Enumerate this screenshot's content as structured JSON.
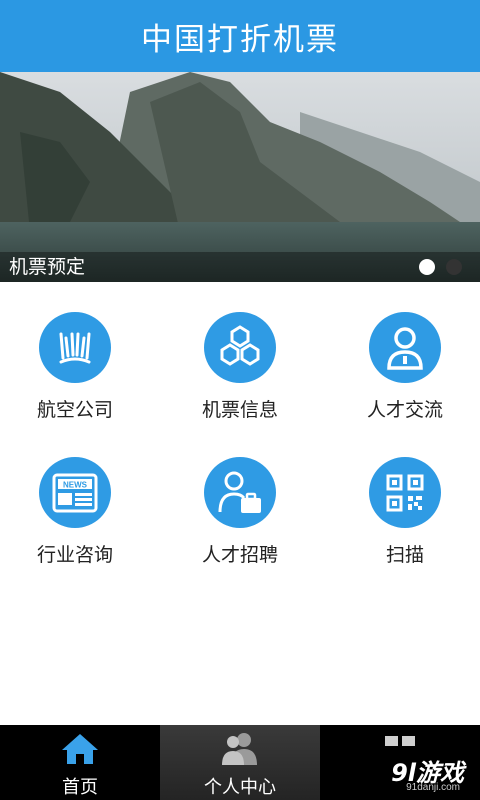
{
  "header": {
    "title": "中国打折机票"
  },
  "banner": {
    "caption": "机票预定",
    "slides_total": 2,
    "active_slide": 1
  },
  "menu": {
    "items": [
      {
        "label": "航空公司",
        "icon": "airline-book-icon"
      },
      {
        "label": "机票信息",
        "icon": "hexagons-icon"
      },
      {
        "label": "人才交流",
        "icon": "person-icon"
      },
      {
        "label": "行业咨询",
        "icon": "news-icon"
      },
      {
        "label": "人才招聘",
        "icon": "recruit-icon"
      },
      {
        "label": "扫描",
        "icon": "qr-code-icon"
      }
    ]
  },
  "tabbar": {
    "tabs": [
      {
        "label": "首页",
        "icon": "home-icon"
      },
      {
        "label": "个人中心",
        "icon": "users-icon"
      },
      {
        "label": "",
        "icon": "grid-icon"
      }
    ]
  },
  "watermark": {
    "logo": "9l游戏",
    "url": "91danji.com"
  },
  "colors": {
    "accent": "#2b98e3",
    "icon_bg": "#2f9be4",
    "tabbar": "#1c1c1c"
  }
}
